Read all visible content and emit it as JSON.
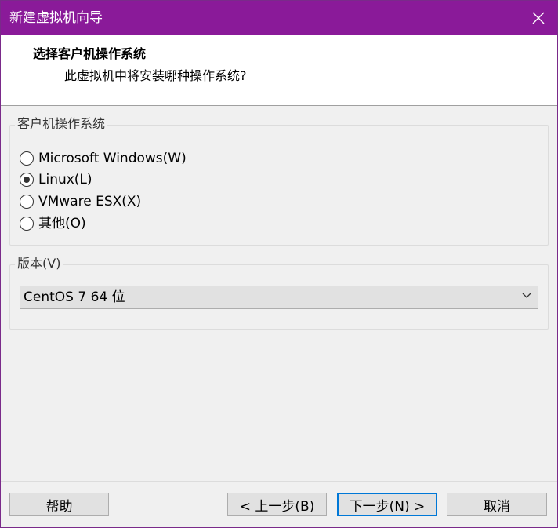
{
  "window": {
    "title": "新建虚拟机向导",
    "titlebar_color": "#8a1a99"
  },
  "header": {
    "title": "选择客户机操作系统",
    "subtitle": "此虚拟机中将安装哪种操作系统?"
  },
  "os_group": {
    "label": "客户机操作系统",
    "options": [
      {
        "label": "Microsoft Windows(W)",
        "checked": false
      },
      {
        "label": "Linux(L)",
        "checked": true
      },
      {
        "label": "VMware ESX(X)",
        "checked": false
      },
      {
        "label": "其他(O)",
        "checked": false
      }
    ]
  },
  "version_group": {
    "label": "版本(V)",
    "selected": "CentOS 7 64 位"
  },
  "buttons": {
    "help": "帮助",
    "back": "< 上一步(B)",
    "next": "下一步(N) >",
    "cancel": "取消"
  }
}
